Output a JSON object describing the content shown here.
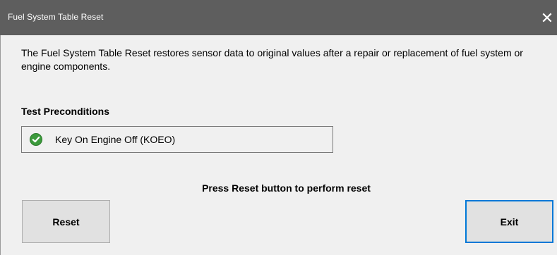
{
  "window": {
    "title": "Fuel System Table Reset",
    "close_glyph": "✕"
  },
  "description": "The Fuel System Table Reset restores sensor data to original values after a repair or replacement of fuel system or engine components.",
  "preconditions": {
    "heading": "Test Preconditions",
    "items": [
      {
        "label": "Key On Engine Off (KOEO)",
        "status": "passed",
        "icon": "check-circle-icon",
        "icon_color": "#3c9a3c"
      }
    ]
  },
  "instruction": "Press Reset button to perform reset",
  "buttons": {
    "reset": "Reset",
    "exit": "Exit"
  },
  "colors": {
    "titlebar": "#5e5e5e",
    "focus_border": "#0078d7",
    "button_face": "#e1e1e1"
  }
}
